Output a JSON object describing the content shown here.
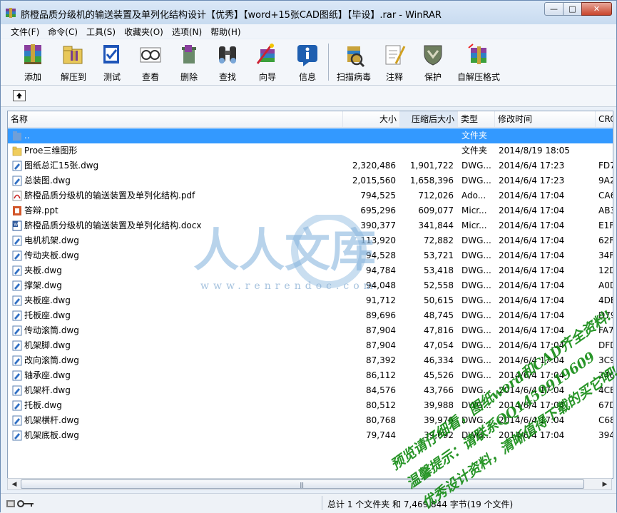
{
  "window": {
    "title": "脐橙品质分级机的输送装置及单列化结构设计【优秀】【word+15张CAD图纸】【毕设】.rar - WinRAR",
    "buttons": {
      "minimize": "—",
      "maximize": "□",
      "close": "✕"
    }
  },
  "menu": [
    "文件(F)",
    "命令(C)",
    "工具(S)",
    "收藏夹(O)",
    "选项(N)",
    "帮助(H)"
  ],
  "toolbar": [
    {
      "label": "添加",
      "icon": "add-archive-icon"
    },
    {
      "label": "解压到",
      "icon": "extract-to-icon"
    },
    {
      "label": "测试",
      "icon": "test-icon"
    },
    {
      "label": "查看",
      "icon": "view-icon"
    },
    {
      "label": "删除",
      "icon": "delete-icon"
    },
    {
      "label": "查找",
      "icon": "find-icon"
    },
    {
      "label": "向导",
      "icon": "wizard-icon"
    },
    {
      "label": "信息",
      "icon": "info-icon"
    },
    {
      "label": "扫描病毒",
      "icon": "virus-scan-icon"
    },
    {
      "label": "注释",
      "icon": "comment-icon"
    },
    {
      "label": "保护",
      "icon": "protect-icon"
    },
    {
      "label": "自解压格式",
      "icon": "sfx-icon"
    }
  ],
  "columns": {
    "name": "名称",
    "size": "大小",
    "packed": "压缩后大小",
    "type": "类型",
    "modified": "修改时间",
    "crc": "CRC"
  },
  "files": [
    {
      "name": "..",
      "size": "",
      "packed": "",
      "type": "文件夹",
      "modified": "",
      "crc": "",
      "kind": "up"
    },
    {
      "name": "Proe三维图形",
      "size": "",
      "packed": "",
      "type": "文件夹",
      "modified": "2014/8/19 18:05",
      "crc": "",
      "kind": "folder"
    },
    {
      "name": "图纸总汇15张.dwg",
      "size": "2,320,486",
      "packed": "1,901,722",
      "type": "DWG...",
      "modified": "2014/6/4 17:23",
      "crc": "FD7",
      "kind": "dwg"
    },
    {
      "name": "总装图.dwg",
      "size": "2,015,560",
      "packed": "1,658,396",
      "type": "DWG...",
      "modified": "2014/6/4 17:23",
      "crc": "9A2",
      "kind": "dwg"
    },
    {
      "name": "脐橙品质分级机的输送装置及单列化结构.pdf",
      "size": "794,525",
      "packed": "712,026",
      "type": "Ado...",
      "modified": "2014/6/4 17:04",
      "crc": "CA6",
      "kind": "pdf"
    },
    {
      "name": "答辩.ppt",
      "size": "695,296",
      "packed": "609,077",
      "type": "Micr...",
      "modified": "2014/6/4 17:04",
      "crc": "AB3",
      "kind": "ppt"
    },
    {
      "name": "脐橙品质分级机的输送装置及单列化结构.docx",
      "size": "390,377",
      "packed": "341,844",
      "type": "Micr...",
      "modified": "2014/6/4 17:04",
      "crc": "E1F",
      "kind": "doc"
    },
    {
      "name": "电机机架.dwg",
      "size": "113,920",
      "packed": "72,882",
      "type": "DWG...",
      "modified": "2014/6/4 17:04",
      "crc": "62F",
      "kind": "dwg"
    },
    {
      "name": "传动夹板.dwg",
      "size": "94,528",
      "packed": "53,721",
      "type": "DWG...",
      "modified": "2014/6/4 17:04",
      "crc": "34F",
      "kind": "dwg"
    },
    {
      "name": "夹板.dwg",
      "size": "94,784",
      "packed": "53,418",
      "type": "DWG...",
      "modified": "2014/6/4 17:04",
      "crc": "12D",
      "kind": "dwg"
    },
    {
      "name": "撑架.dwg",
      "size": "94,048",
      "packed": "52,558",
      "type": "DWG...",
      "modified": "2014/6/4 17:04",
      "crc": "A0D",
      "kind": "dwg"
    },
    {
      "name": "夹板座.dwg",
      "size": "91,712",
      "packed": "50,615",
      "type": "DWG...",
      "modified": "2014/6/4 17:04",
      "crc": "4DE",
      "kind": "dwg"
    },
    {
      "name": "托板座.dwg",
      "size": "89,696",
      "packed": "48,745",
      "type": "DWG...",
      "modified": "2014/6/4 17:04",
      "crc": "D79",
      "kind": "dwg"
    },
    {
      "name": "传动滚筒.dwg",
      "size": "87,904",
      "packed": "47,816",
      "type": "DWG...",
      "modified": "2014/6/4 17:04",
      "crc": "FA7",
      "kind": "dwg"
    },
    {
      "name": "机架脚.dwg",
      "size": "87,904",
      "packed": "47,054",
      "type": "DWG...",
      "modified": "2014/6/4 17:04",
      "crc": "DFD",
      "kind": "dwg"
    },
    {
      "name": "改向滚筒.dwg",
      "size": "87,392",
      "packed": "46,334",
      "type": "DWG...",
      "modified": "2014/6/4 17:04",
      "crc": "3C9",
      "kind": "dwg"
    },
    {
      "name": "轴承座.dwg",
      "size": "86,112",
      "packed": "45,526",
      "type": "DWG...",
      "modified": "2014/6/4 17:04",
      "crc": "246",
      "kind": "dwg"
    },
    {
      "name": "机架杆.dwg",
      "size": "84,576",
      "packed": "43,766",
      "type": "DWG...",
      "modified": "2014/6/4 17:04",
      "crc": "4CE",
      "kind": "dwg"
    },
    {
      "name": "托板.dwg",
      "size": "80,512",
      "packed": "39,988",
      "type": "DWG...",
      "modified": "2014/6/4 17:04",
      "crc": "67D",
      "kind": "dwg"
    },
    {
      "name": "机架横杆.dwg",
      "size": "80,768",
      "packed": "39,976",
      "type": "DWG...",
      "modified": "2014/6/4 17:04",
      "crc": "C68",
      "kind": "dwg"
    },
    {
      "name": "机架底板.dwg",
      "size": "79,744",
      "packed": "39,092",
      "type": "DWG...",
      "modified": "2014/6/4 17:04",
      "crc": "394",
      "kind": "dwg"
    }
  ],
  "selected_index": 0,
  "scrollbar": {
    "grip": "|||"
  },
  "status": {
    "summary": "总计 1 个文件夹 和 7,469,844 字节(19 个文件)"
  },
  "watermark": {
    "logo_text": "人人文库",
    "url": "www.renrendoc.com",
    "green_lines": [
      "预览请仔细看，图纸word和CAD齐全资料!",
      "温馨提示：请联系QQ1459919609",
      "优秀设计资料，清晰值得下载的买它吧!"
    ]
  },
  "colors": {
    "selection": "#3399ff",
    "watermark_blue": "#8fb3d6",
    "watermark_green": "#118a11"
  }
}
